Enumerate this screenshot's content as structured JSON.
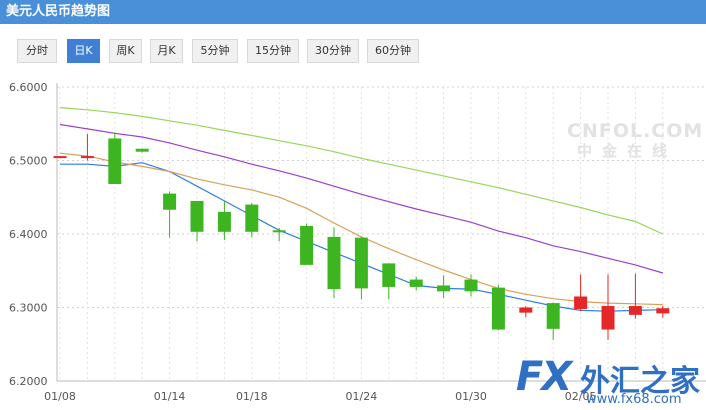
{
  "title": "美元人民币趋势图",
  "tabs": [
    {
      "label": "分时",
      "active": false
    },
    {
      "label": "日K",
      "active": true
    },
    {
      "label": "周K",
      "active": false
    },
    {
      "label": "月K",
      "active": false
    },
    {
      "label": "5分钟",
      "active": false
    },
    {
      "label": "15分钟",
      "active": false
    },
    {
      "label": "30分钟",
      "active": false
    },
    {
      "label": "60分钟",
      "active": false
    }
  ],
  "watermarks": {
    "cnfol_en": "CNFOL.COM",
    "cnfol_cn": "中金在线",
    "fx68_logo": "FX",
    "fx68_name": "外汇之家",
    "fx68_url": "www.fx68.com"
  },
  "colors": {
    "header": "#4a90d8",
    "tab_active": "#3f7fd4",
    "up_candle": "#e52727",
    "down_candle": "#3cb521",
    "ma_blue": "#2e7fe0",
    "ma_orange": "#d9a05a",
    "ma_purple": "#9a3fcf",
    "ma_green": "#9ad45a"
  },
  "chart_data": {
    "type": "candlestick",
    "ylim": [
      6.2,
      6.6
    ],
    "y_ticks": [
      6.6,
      6.5,
      6.4,
      6.3,
      6.2
    ],
    "y_tick_labels": [
      "6.6000",
      "6.5000",
      "6.4000",
      "6.3000",
      "6.2000"
    ],
    "x_tick_labels": [
      {
        "label": "01/08",
        "index": 0
      },
      {
        "label": "01/14",
        "index": 4
      },
      {
        "label": "01/18",
        "index": 7
      },
      {
        "label": "01/24",
        "index": 11
      },
      {
        "label": "01/30",
        "index": 15
      },
      {
        "label": "02/05",
        "index": 19
      }
    ],
    "grid": true,
    "candles": [
      {
        "date": "01/08",
        "open": 6.506,
        "high": 6.506,
        "low": 6.506,
        "close": 6.506
      },
      {
        "date": "01/09",
        "open": 6.505,
        "high": 6.536,
        "low": 6.5,
        "close": 6.506
      },
      {
        "date": "01/10",
        "open": 6.53,
        "high": 6.538,
        "low": 6.468,
        "close": 6.468
      },
      {
        "date": "01/11",
        "open": 6.516,
        "high": 6.516,
        "low": 6.511,
        "close": 6.512
      },
      {
        "date": "01/12",
        "open": 6.455,
        "high": 6.458,
        "low": 6.395,
        "close": 6.433
      },
      {
        "date": "01/15",
        "open": 6.445,
        "high": 6.445,
        "low": 6.39,
        "close": 6.403
      },
      {
        "date": "01/16",
        "open": 6.43,
        "high": 6.445,
        "low": 6.392,
        "close": 6.403
      },
      {
        "date": "01/17",
        "open": 6.44,
        "high": 6.442,
        "low": 6.396,
        "close": 6.403
      },
      {
        "date": "01/18",
        "open": 6.405,
        "high": 6.408,
        "low": 6.39,
        "close": 6.403
      },
      {
        "date": "01/19",
        "open": 6.411,
        "high": 6.414,
        "low": 6.358,
        "close": 6.358
      },
      {
        "date": "01/22",
        "open": 6.396,
        "high": 6.409,
        "low": 6.313,
        "close": 6.325
      },
      {
        "date": "01/23",
        "open": 6.395,
        "high": 6.396,
        "low": 6.311,
        "close": 6.326
      },
      {
        "date": "01/24",
        "open": 6.36,
        "high": 6.36,
        "low": 6.311,
        "close": 6.328
      },
      {
        "date": "01/25",
        "open": 6.338,
        "high": 6.342,
        "low": 6.323,
        "close": 6.328
      },
      {
        "date": "01/26",
        "open": 6.33,
        "high": 6.344,
        "low": 6.313,
        "close": 6.322
      },
      {
        "date": "01/29",
        "open": 6.338,
        "high": 6.345,
        "low": 6.315,
        "close": 6.322
      },
      {
        "date": "01/30",
        "open": 6.327,
        "high": 6.331,
        "low": 6.269,
        "close": 6.27
      },
      {
        "date": "01/31",
        "open": 6.293,
        "high": 6.302,
        "low": 6.287,
        "close": 6.3
      },
      {
        "date": "02/01",
        "open": 6.306,
        "high": 6.307,
        "low": 6.256,
        "close": 6.271
      },
      {
        "date": "02/02",
        "open": 6.298,
        "high": 6.345,
        "low": 6.295,
        "close": 6.315
      },
      {
        "date": "02/05",
        "open": 6.27,
        "high": 6.345,
        "low": 6.256,
        "close": 6.302
      },
      {
        "date": "02/06",
        "open": 6.29,
        "high": 6.346,
        "low": 6.285,
        "close": 6.302
      },
      {
        "date": "02/07",
        "open": 6.292,
        "high": 6.302,
        "low": 6.286,
        "close": 6.299
      }
    ],
    "series": [
      {
        "color": "blue",
        "values": [
          6.495,
          6.495,
          6.492,
          6.497,
          6.485,
          6.465,
          6.445,
          6.425,
          6.405,
          6.39,
          6.375,
          6.36,
          6.345,
          6.33,
          6.326,
          6.325,
          6.318,
          6.31,
          6.302,
          6.296,
          6.295,
          6.296,
          6.297
        ]
      },
      {
        "color": "orange",
        "values": [
          6.51,
          6.506,
          6.498,
          6.492,
          6.485,
          6.475,
          6.467,
          6.46,
          6.45,
          6.435,
          6.415,
          6.396,
          6.38,
          6.365,
          6.351,
          6.338,
          6.326,
          6.318,
          6.312,
          6.308,
          6.306,
          6.305,
          6.304
        ]
      },
      {
        "color": "purple",
        "values": [
          6.549,
          6.543,
          6.537,
          6.532,
          6.524,
          6.514,
          6.505,
          6.495,
          6.486,
          6.476,
          6.465,
          6.454,
          6.444,
          6.434,
          6.425,
          6.416,
          6.404,
          6.395,
          6.384,
          6.376,
          6.367,
          6.358,
          6.347
        ]
      },
      {
        "color": "green",
        "values": [
          6.572,
          6.569,
          6.565,
          6.56,
          6.554,
          6.548,
          6.541,
          6.534,
          6.527,
          6.52,
          6.512,
          6.503,
          6.495,
          6.487,
          6.479,
          6.471,
          6.463,
          6.454,
          6.445,
          6.436,
          6.426,
          6.417,
          6.4
        ]
      }
    ]
  }
}
